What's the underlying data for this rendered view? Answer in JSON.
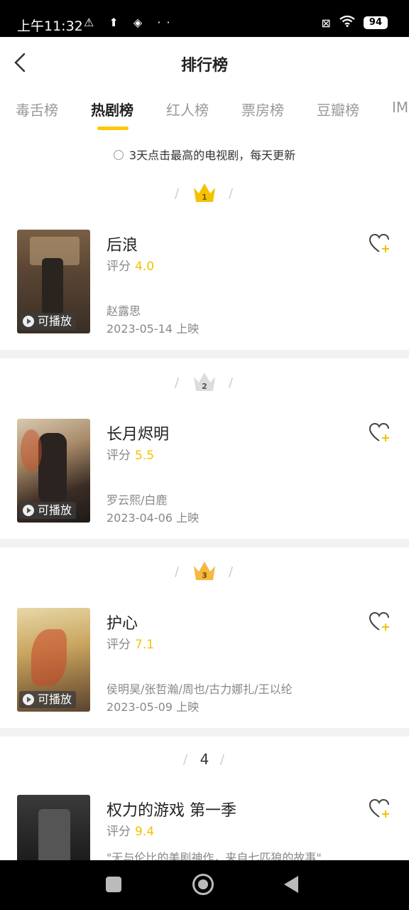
{
  "status_bar": {
    "time": "上午11:32",
    "icons_left": "⚠ ⬆ ◈ ··",
    "battery": "94"
  },
  "header": {
    "title": "排行榜"
  },
  "tabs": [
    {
      "label": "毒舌榜"
    },
    {
      "label": "热剧榜"
    },
    {
      "label": "红人榜"
    },
    {
      "label": "票房榜"
    },
    {
      "label": "豆瓣榜"
    },
    {
      "label": "IM"
    }
  ],
  "notice": "3天点击最高的电视剧，每天更新",
  "score_label": "评分",
  "play_label": "可播放",
  "items": [
    {
      "rank": "1",
      "name": "后浪",
      "score": "4.0",
      "actors": "赵露思",
      "date": "2023-05-14 上映",
      "crown_color": "#f5c100"
    },
    {
      "rank": "2",
      "name": "长月烬明",
      "score": "5.5",
      "actors": "罗云熙/白鹿",
      "date": "2023-04-06 上映",
      "crown_color": "#d4d4d4"
    },
    {
      "rank": "3",
      "name": "护心",
      "score": "7.1",
      "actors": "侯明昊/张哲瀚/周也/古力娜扎/王以纶",
      "date": "2023-05-09 上映",
      "crown_color": "#f5b840"
    },
    {
      "rank": "4",
      "name": "权力的游戏 第一季",
      "score": "9.4",
      "quote": "\"无与伦比的美剧神作，来自七匹狼的故事\""
    }
  ],
  "colors": {
    "accent": "#ffc700",
    "score": "#f5c100"
  }
}
